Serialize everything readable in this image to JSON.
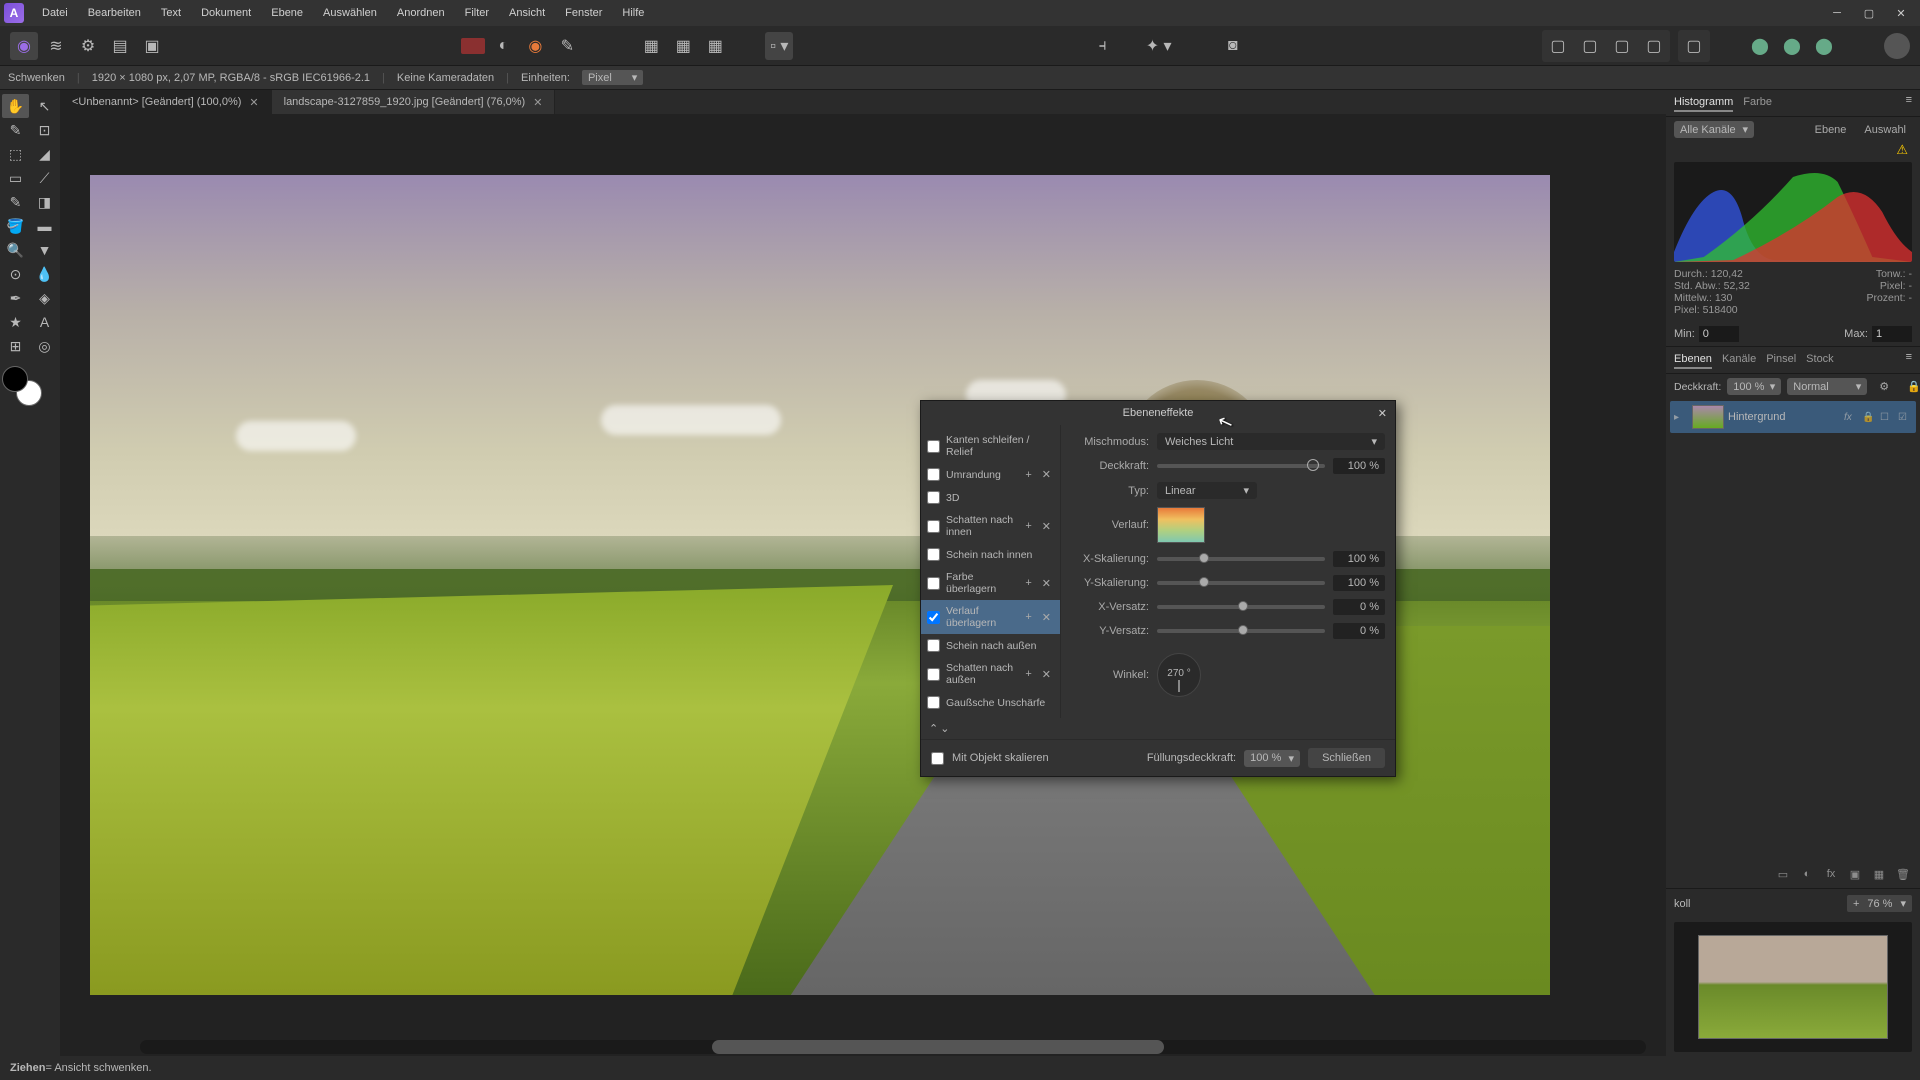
{
  "menu": {
    "items": [
      "Datei",
      "Bearbeiten",
      "Text",
      "Dokument",
      "Ebene",
      "Auswählen",
      "Anordnen",
      "Filter",
      "Ansicht",
      "Fenster",
      "Hilfe"
    ]
  },
  "context": {
    "tool": "Schwenken",
    "dims": "1920 × 1080 px, 2,07 MP, RGBA/8 - sRGB IEC61966-2.1",
    "camera": "Keine Kameradaten",
    "units_label": "Einheiten:",
    "units_value": "Pixel"
  },
  "tabs": [
    {
      "label": "<Unbenannt> [Geändert] (100,0%)"
    },
    {
      "label": "landscape-3127859_1920.jpg [Geändert] (76,0%)"
    }
  ],
  "right": {
    "histo_tab": "Histogramm",
    "color_tab": "Farbe",
    "channel_label": "Alle Kanäle",
    "ebene_btn": "Ebene",
    "auswahl_btn": "Auswahl",
    "stats": {
      "durch": "Durch.: 120,42",
      "stdabw": "Std. Abw.: 52,32",
      "mittelw": "Mittelw.: 130",
      "pixel": "Pixel: 518400",
      "tonw": "Tonw.: -",
      "pixel2": "Pixel: -",
      "prozent": "Prozent: -"
    },
    "min_label": "Min:",
    "min_val": "0",
    "max_label": "Max:",
    "max_val": "1",
    "layer_tabs": [
      "Ebenen",
      "Kanäle",
      "Pinsel",
      "Stock"
    ],
    "opacity_label": "Deckkraft:",
    "opacity_val": "100 %",
    "blend_val": "Normal",
    "layer_name": "Hintergrund",
    "layer_fx": "fx",
    "collapsed_tab": "koll",
    "zoom_val": "76 %"
  },
  "dialog": {
    "title": "Ebeneneffekte",
    "fx": [
      {
        "label": "Kanten schleifen / Relief",
        "chk": false,
        "plus": false,
        "x": false
      },
      {
        "label": "Umrandung",
        "chk": false,
        "plus": true,
        "x": true
      },
      {
        "label": "3D",
        "chk": false,
        "plus": false,
        "x": false
      },
      {
        "label": "Schatten nach innen",
        "chk": false,
        "plus": true,
        "x": true
      },
      {
        "label": "Schein nach innen",
        "chk": false,
        "plus": false,
        "x": false
      },
      {
        "label": "Farbe überlagern",
        "chk": false,
        "plus": true,
        "x": true
      },
      {
        "label": "Verlauf überlagern",
        "chk": true,
        "plus": true,
        "x": true,
        "sel": true
      },
      {
        "label": "Schein nach außen",
        "chk": false,
        "plus": false,
        "x": false
      },
      {
        "label": "Schatten nach außen",
        "chk": false,
        "plus": true,
        "x": true
      },
      {
        "label": "Gaußsche Unschärfe",
        "chk": false,
        "plus": false,
        "x": false
      }
    ],
    "props": {
      "mischmodus_label": "Mischmodus:",
      "mischmodus_val": "Weiches Licht",
      "deckkraft_label": "Deckkraft:",
      "deckkraft_val": "100 %",
      "typ_label": "Typ:",
      "typ_val": "Linear",
      "verlauf_label": "Verlauf:",
      "xscale_label": "X-Skalierung:",
      "xscale_val": "100 %",
      "yscale_label": "Y-Skalierung:",
      "yscale_val": "100 %",
      "xoff_label": "X-Versatz:",
      "xoff_val": "0 %",
      "yoff_label": "Y-Versatz:",
      "yoff_val": "0 %",
      "winkel_label": "Winkel:",
      "winkel_val": "270 °"
    },
    "scale_label": "Mit Objekt skalieren",
    "fill_opacity_label": "Füllungsdeckkraft:",
    "fill_opacity_val": "100 %",
    "close_btn": "Schließen"
  },
  "status": {
    "bold": "Ziehen",
    "rest": " = Ansicht schwenken."
  }
}
